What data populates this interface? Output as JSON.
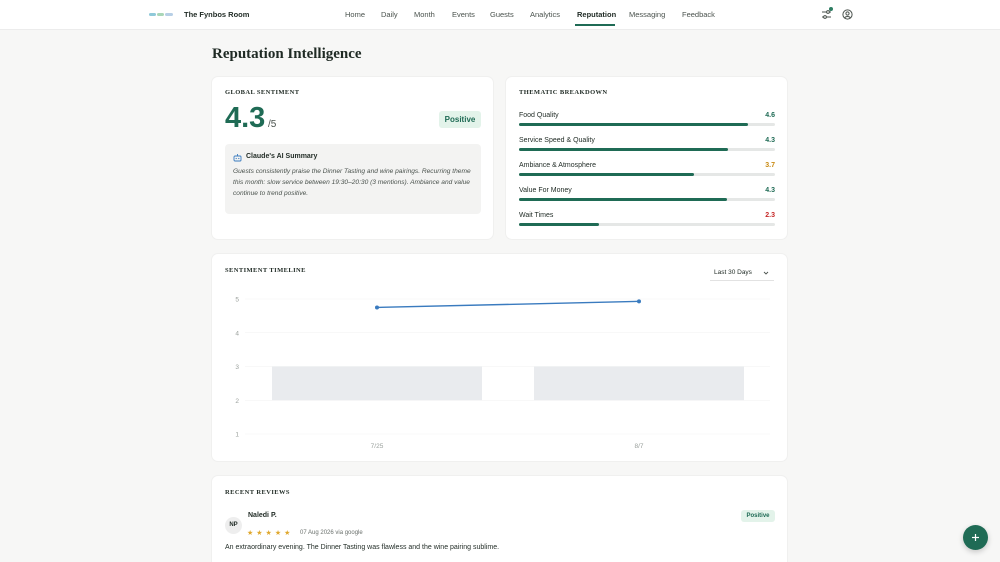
{
  "header": {
    "logo_icon": "restaurant-logo",
    "venue_name": "The Fynbos Room",
    "nav": [
      {
        "label": "Home"
      },
      {
        "label": "Daily"
      },
      {
        "label": "Month"
      },
      {
        "label": "Events"
      },
      {
        "label": "Guests"
      },
      {
        "label": "Analytics"
      },
      {
        "label": "Reputation",
        "active": true
      },
      {
        "label": "Messaging"
      },
      {
        "label": "Feedback"
      }
    ],
    "icons": [
      "settings-sliders-icon",
      "user-account-icon"
    ]
  },
  "page_title": "Reputation Intelligence",
  "global_sentiment": {
    "heading": "Global Sentiment",
    "score": "4.3",
    "max": "/5",
    "badge": "Positive",
    "ai_summary": {
      "title": "Claude's AI Summary",
      "text": "Guests consistently praise the Dinner Tasting and wine pairings. Recurring theme this month: slow service between 19:30–20:30 (3 mentions). Ambiance and value continue to trend positive."
    }
  },
  "thematic_breakdown": {
    "heading": "Thematic Breakdown",
    "items": [
      {
        "label": "Food Quality",
        "value": "4.6",
        "level": 0.896,
        "color": "#1f6b55"
      },
      {
        "label": "Service Speed & Quality",
        "value": "4.3",
        "level": 0.816,
        "color": "#1f6b55"
      },
      {
        "label": "Ambiance & Atmosphere",
        "value": "3.7",
        "level": 0.684,
        "color": "#c98a12"
      },
      {
        "label": "Value For Money",
        "value": "4.3",
        "level": 0.812,
        "color": "#1f6b55"
      },
      {
        "label": "Wait Times",
        "value": "2.3",
        "level": 0.313,
        "color": "#c62828"
      }
    ]
  },
  "timeline": {
    "heading": "Sentiment Timeline",
    "range_label": "Last 30 Days",
    "chart_data": {
      "type": "line",
      "x": [
        "7/25",
        "8/7"
      ],
      "yticks": [
        "1",
        "2",
        "3",
        "4",
        "5"
      ],
      "ylim": [
        1,
        5
      ],
      "series": [
        {
          "values": [
            4.75,
            4.93
          ]
        }
      ],
      "bands": [
        {
          "x": "7/25",
          "from": 2,
          "to": 3
        },
        {
          "x": "8/7",
          "from": 2,
          "to": 3
        }
      ],
      "line_color": "#3a7bbf",
      "band_color": "#e9ebee"
    }
  },
  "reviews": {
    "heading": "Recent Reviews",
    "items": [
      {
        "initials": "NP",
        "name": "Naledi P.",
        "stars": "★★★★★",
        "rating": 5,
        "meta": "07 Aug 2026 via google",
        "badge": "Positive",
        "text": "An extraordinary evening. The Dinner Tasting was flawless and the wine pairing sublime."
      }
    ]
  },
  "fab_icon": "sparkle-plus-icon"
}
